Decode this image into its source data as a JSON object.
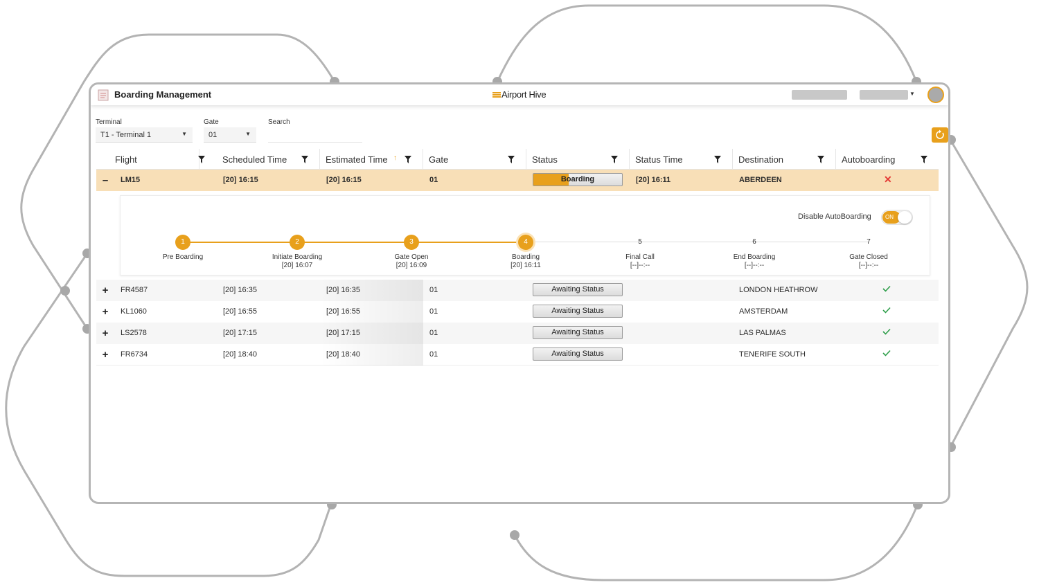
{
  "app": {
    "title": "Boarding Management",
    "brand": "Airport Hive"
  },
  "filters": {
    "terminal_label": "Terminal",
    "terminal_value": "T1 - Terminal 1",
    "gate_label": "Gate",
    "gate_value": "01",
    "search_label": "Search",
    "search_value": ""
  },
  "table": {
    "columns": [
      "Flight",
      "Scheduled Time",
      "Estimated Time",
      "Gate",
      "Status",
      "Status Time",
      "Destination",
      "Autoboarding"
    ],
    "active_row": {
      "toggle": "–",
      "flight": "LM15",
      "scheduled": "[20] 16:15",
      "estimated": "[20] 16:15",
      "gate": "01",
      "status": "Boarding",
      "status_progress": 0.4,
      "status_time": "[20] 16:11",
      "destination": "ABERDEEN",
      "autoboarding": "✕"
    },
    "rows": [
      {
        "toggle": "+",
        "flight": "FR4587",
        "scheduled": "[20] 16:35",
        "estimated": "[20] 16:35",
        "gate": "01",
        "status": "Awaiting Status",
        "status_time": "",
        "destination": "LONDON HEATHROW"
      },
      {
        "toggle": "+",
        "flight": "KL1060",
        "scheduled": "[20] 16:55",
        "estimated": "[20] 16:55",
        "gate": "01",
        "status": "Awaiting Status",
        "status_time": "",
        "destination": "AMSTERDAM"
      },
      {
        "toggle": "+",
        "flight": "LS2578",
        "scheduled": "[20] 17:15",
        "estimated": "[20] 17:15",
        "gate": "01",
        "status": "Awaiting Status",
        "status_time": "",
        "destination": "LAS PALMAS"
      },
      {
        "toggle": "+",
        "flight": "FR6734",
        "scheduled": "[20] 18:40",
        "estimated": "[20] 18:40",
        "gate": "01",
        "status": "Awaiting Status",
        "status_time": "",
        "destination": "TENERIFE SOUTH"
      }
    ]
  },
  "detail": {
    "toggle_label": "Disable AutoBoarding",
    "toggle_state": "ON",
    "steps": [
      {
        "num": "1",
        "label": "Pre Boarding",
        "time": "",
        "done": true
      },
      {
        "num": "2",
        "label": "Initiate Boarding",
        "time": "[20] 16:07",
        "done": true
      },
      {
        "num": "3",
        "label": "Gate Open",
        "time": "[20] 16:09",
        "done": true
      },
      {
        "num": "4",
        "label": "Boarding",
        "time": "[20] 16:11",
        "done": true
      },
      {
        "num": "5",
        "label": "Final Call",
        "time": "[--]--:--",
        "done": false
      },
      {
        "num": "6",
        "label": "End Boarding",
        "time": "[--]--:--",
        "done": false
      },
      {
        "num": "7",
        "label": "Gate Closed",
        "time": "[--]--:--",
        "done": false
      }
    ]
  },
  "colors": {
    "accent": "#e8a01c",
    "active_row": "#f8dfb7",
    "frame": "#b5b5b5",
    "check": "#2e9e4a",
    "cross": "#e53935"
  }
}
